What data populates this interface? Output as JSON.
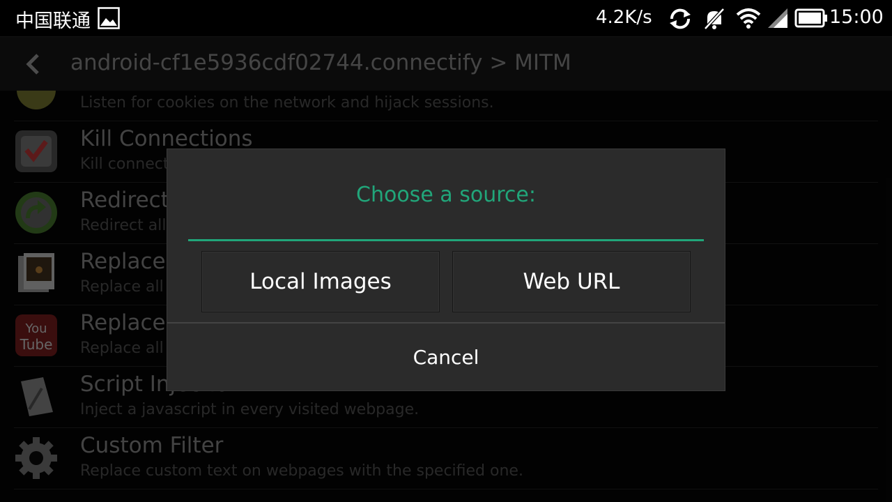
{
  "status_bar": {
    "carrier": "中国联通",
    "speed": "4.2K/s",
    "time": "15:00",
    "icons": [
      "image-icon",
      "sync-icon",
      "mute-icon",
      "wifi-icon",
      "signal-icon",
      "battery-icon"
    ]
  },
  "action_bar": {
    "title": "android-cf1e5936cdf02744.connectify > MITM"
  },
  "list": {
    "items": [
      {
        "title": "",
        "subtitle": "Listen for cookies on the network and hijack sessions.",
        "icon": "cookie-icon"
      },
      {
        "title": "Kill Connections",
        "subtitle": "Kill connections",
        "icon": "kill-connections-icon"
      },
      {
        "title": "Redirect",
        "subtitle": "Redirect all",
        "icon": "redirect-icon"
      },
      {
        "title": "Replace",
        "subtitle": "Replace all",
        "icon": "replace-images-icon"
      },
      {
        "title": "Replace",
        "subtitle": "Replace all",
        "icon": "youtube-icon"
      },
      {
        "title": "Script Injection",
        "subtitle": "Inject a javascript in every visited webpage.",
        "icon": "script-injection-icon"
      },
      {
        "title": "Custom Filter",
        "subtitle": "Replace custom text on webpages with the specified one.",
        "icon": "gear-icon"
      }
    ]
  },
  "dialog": {
    "title": "Choose a source:",
    "local_images": "Local Images",
    "web_url": "Web URL",
    "cancel": "Cancel"
  },
  "colors": {
    "accent": "#21a67a",
    "dialog_bg": "#2b2b2b",
    "action_bar_bg": "#141414"
  }
}
